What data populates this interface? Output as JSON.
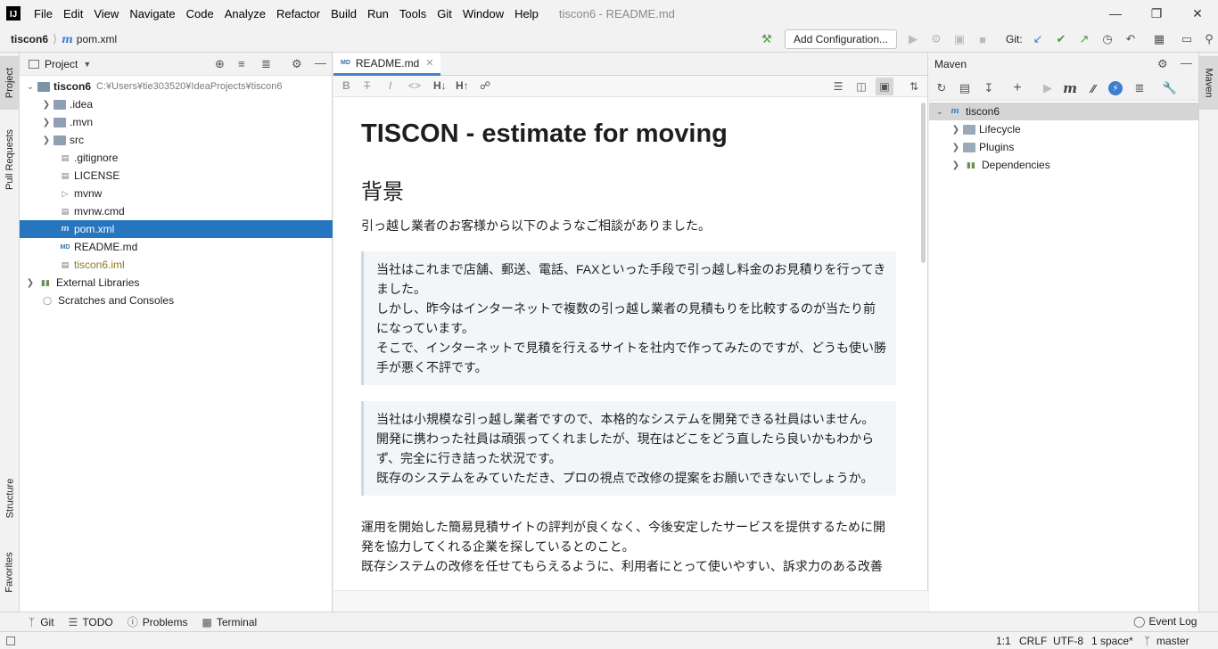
{
  "menu": [
    "File",
    "Edit",
    "View",
    "Navigate",
    "Code",
    "Analyze",
    "Refactor",
    "Build",
    "Run",
    "Tools",
    "Git",
    "Window",
    "Help"
  ],
  "window_title": "tiscon6 - README.md",
  "breadcrumb": {
    "project": "tiscon6",
    "file": "pom.xml"
  },
  "toolbar": {
    "add_config": "Add Configuration...",
    "git_label": "Git:"
  },
  "left_stripe": {
    "project": "Project",
    "pull_requests": "Pull Requests",
    "structure": "Structure",
    "favorites": "Favorites"
  },
  "project_panel": {
    "title": "Project",
    "tree": [
      {
        "label": "tiscon6",
        "path": "C:¥Users¥tie303520¥IdeaProjects¥tiscon6"
      },
      {
        "label": ".idea"
      },
      {
        "label": ".mvn"
      },
      {
        "label": "src"
      },
      {
        "label": ".gitignore"
      },
      {
        "label": "LICENSE"
      },
      {
        "label": "mvnw"
      },
      {
        "label": "mvnw.cmd"
      },
      {
        "label": "pom.xml"
      },
      {
        "label": "README.md"
      },
      {
        "label": "tiscon6.iml"
      },
      {
        "label": "External Libraries"
      },
      {
        "label": "Scratches and Consoles"
      }
    ]
  },
  "editor": {
    "tab": "README.md",
    "h1": "TISCON - estimate for moving",
    "h2": "背景",
    "intro": "引っ越し業者のお客様から以下のようなご相談がありました。",
    "quote1": [
      "当社はこれまで店舗、郵送、電話、FAXといった手段で引っ越し料金のお見積りを行ってきました。",
      "しかし、昨今はインターネットで複数の引っ越し業者の見積もりを比較するのが当たり前になっています。",
      "そこで、インターネットで見積を行えるサイトを社内で作ってみたのですが、どうも使い勝手が悪く不評です。"
    ],
    "quote2": [
      "当社は小規模な引っ越し業者ですので、本格的なシステムを開発できる社員はいません。",
      "開発に携わった社員は頑張ってくれましたが、現在はどこをどう直したら良いかもわからず、完全に行き詰った状況です。",
      "既存のシステムをみていただき、プロの視点で改修の提案をお願いできないでしょうか。"
    ],
    "para": [
      "運用を開始した簡易見積サイトの評判が良くなく、今後安定したサービスを提供するために開発を協力してくれる企業を探しているとのこと。",
      "既存システムの改修を任せてもらえるように、利用者にとって使いやすい、訴求力のある改善"
    ]
  },
  "maven": {
    "title": "Maven",
    "stripe": "Maven",
    "tree": [
      "tiscon6",
      "Lifecycle",
      "Plugins",
      "Dependencies"
    ]
  },
  "bottom_tabs": [
    "Git",
    "TODO",
    "Problems",
    "Terminal"
  ],
  "event_log": "Event Log",
  "status": {
    "pos": "1:1",
    "eol": "CRLF",
    "enc": "UTF-8",
    "indent": "1 space*",
    "branch": "master"
  }
}
